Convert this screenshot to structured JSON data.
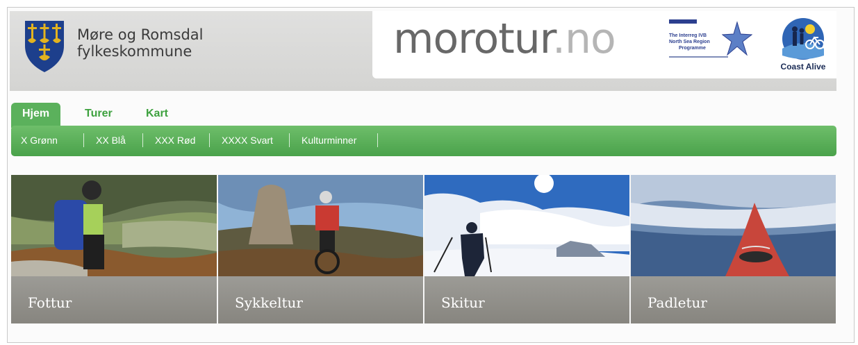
{
  "header": {
    "org_name_line1": "Møre og Romsdal",
    "org_name_line2": "fylkeskommune",
    "logo_main": "morotur",
    "logo_tld": ".no",
    "interreg_line1": "The Interreg IVB",
    "interreg_line2": "North Sea Region",
    "interreg_line3": "Programme",
    "coast_alive": "Coast Alive"
  },
  "tabs": [
    {
      "label": "Hjem",
      "active": true
    },
    {
      "label": "Turer",
      "active": false
    },
    {
      "label": "Kart",
      "active": false
    }
  ],
  "subnav": [
    "X Grønn",
    "XX Blå",
    "XXX Rød",
    "XXXX Svart",
    "Kulturminner"
  ],
  "tiles": [
    {
      "label": "Fottur",
      "icon": "hiker-photo"
    },
    {
      "label": "Sykkeltur",
      "icon": "cyclist-photo"
    },
    {
      "label": "Skitur",
      "icon": "skier-photo"
    },
    {
      "label": "Padletur",
      "icon": "kayak-photo"
    }
  ],
  "colors": {
    "accent_green": "#5bb15c",
    "tab_text_green": "#3da13e",
    "tile_label_bg": "#95938e"
  }
}
